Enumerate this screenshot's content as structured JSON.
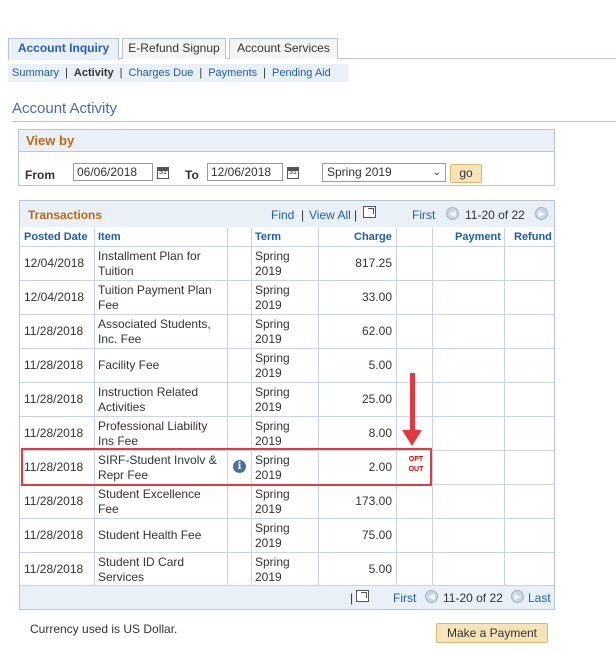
{
  "tabs": [
    {
      "label": "Account Inquiry",
      "active": true
    },
    {
      "label": "E-Refund Signup",
      "active": false
    },
    {
      "label": "Account Services",
      "active": false
    }
  ],
  "subnav": {
    "summary": "Summary",
    "activity": "Activity",
    "charges_due": "Charges Due",
    "payments": "Payments",
    "pending_aid": "Pending Aid",
    "separator": "|"
  },
  "page_title": "Account Activity",
  "view_by": {
    "title": "View by",
    "from_label": "From",
    "from_value": "06/06/2018",
    "to_label": "To",
    "to_value": "12/06/2018",
    "term_selected": "Spring 2019",
    "go_label": "go",
    "calendar_glyph": "31"
  },
  "transactions": {
    "title": "Transactions",
    "find": "Find",
    "separator": "|",
    "view_all": "View All",
    "first": "First",
    "range": "11-20 of 22",
    "last": "Last",
    "columns": {
      "posted_date": "Posted Date",
      "item": "Item",
      "term": "Term",
      "charge": "Charge",
      "payment": "Payment",
      "refund": "Refund"
    },
    "rows": [
      {
        "date": "12/04/2018",
        "item": "Installment Plan for Tuition",
        "term": "Spring 2019",
        "charge": "817.25"
      },
      {
        "date": "12/04/2018",
        "item": "Tuition Payment Plan Fee",
        "term": "Spring 2019",
        "charge": "33.00"
      },
      {
        "date": "11/28/2018",
        "item": "Associated Students, Inc. Fee",
        "term": "Spring 2019",
        "charge": "62.00"
      },
      {
        "date": "11/28/2018",
        "item": "Facility Fee",
        "term": "Spring 2019",
        "charge": "5.00"
      },
      {
        "date": "11/28/2018",
        "item": "Instruction Related Activities",
        "term": "Spring 2019",
        "charge": "25.00"
      },
      {
        "date": "11/28/2018",
        "item": "Professional Liability Ins Fee",
        "term": "Spring 2019",
        "charge": "8.00"
      },
      {
        "date": "11/28/2018",
        "item": "SIRF-Student Involv & Repr Fee",
        "term": "Spring 2019",
        "charge": "2.00",
        "info": "i",
        "optout": "OPT OUT"
      },
      {
        "date": "11/28/2018",
        "item": "Student Excellence Fee",
        "term": "Spring 2019",
        "charge": "173.00"
      },
      {
        "date": "11/28/2018",
        "item": "Student Health Fee",
        "term": "Spring 2019",
        "charge": "75.00"
      },
      {
        "date": "11/28/2018",
        "item": "Student ID Card Services",
        "term": "Spring 2019",
        "charge": "5.00"
      }
    ]
  },
  "currency_note": "Currency used is US Dollar.",
  "make_payment_label": "Make a Payment",
  "colors": {
    "accent_orange": "#c0660e",
    "link_blue": "#1d5ea8",
    "header_bg": "#e9f0f8",
    "highlight_red": "#e0393e"
  }
}
